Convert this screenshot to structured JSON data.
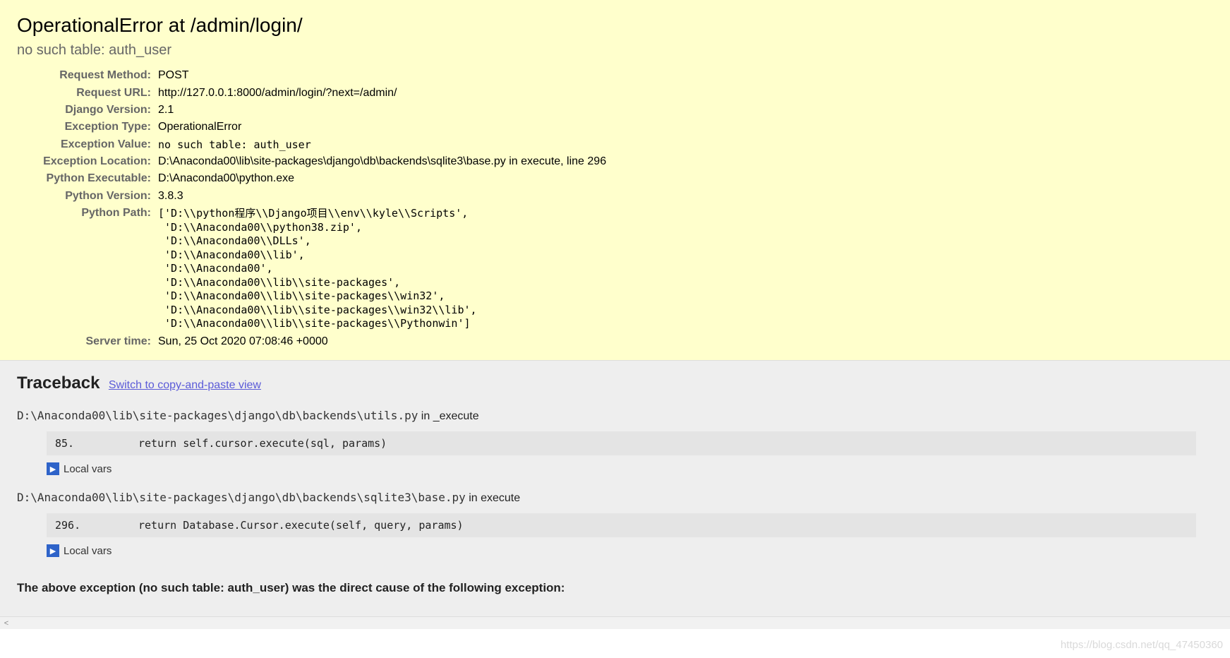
{
  "summary": {
    "title": "OperationalError at /admin/login/",
    "subtitle": "no such table: auth_user",
    "rows": {
      "request_method": {
        "label": "Request Method:",
        "value": "POST"
      },
      "request_url": {
        "label": "Request URL:",
        "value": "http://127.0.0.1:8000/admin/login/?next=/admin/"
      },
      "django_version": {
        "label": "Django Version:",
        "value": "2.1"
      },
      "exception_type": {
        "label": "Exception Type:",
        "value": "OperationalError"
      },
      "exception_value": {
        "label": "Exception Value:",
        "value": "no such table: auth_user"
      },
      "exception_location": {
        "label": "Exception Location:",
        "value": "D:\\Anaconda00\\lib\\site-packages\\django\\db\\backends\\sqlite3\\base.py in execute, line 296"
      },
      "python_executable": {
        "label": "Python Executable:",
        "value": "D:\\Anaconda00\\python.exe"
      },
      "python_version": {
        "label": "Python Version:",
        "value": "3.8.3"
      },
      "python_path": {
        "label": "Python Path:",
        "value": "['D:\\\\python程序\\\\Django项目\\\\env\\\\kyle\\\\Scripts',\n 'D:\\\\Anaconda00\\\\python38.zip',\n 'D:\\\\Anaconda00\\\\DLLs',\n 'D:\\\\Anaconda00\\\\lib',\n 'D:\\\\Anaconda00',\n 'D:\\\\Anaconda00\\\\lib\\\\site-packages',\n 'D:\\\\Anaconda00\\\\lib\\\\site-packages\\\\win32',\n 'D:\\\\Anaconda00\\\\lib\\\\site-packages\\\\win32\\\\lib',\n 'D:\\\\Anaconda00\\\\lib\\\\site-packages\\\\Pythonwin']"
      },
      "server_time": {
        "label": "Server time:",
        "value": "Sun, 25 Oct 2020 07:08:46 +0000"
      }
    }
  },
  "traceback": {
    "heading": "Traceback",
    "switch_link": "Switch to copy-and-paste view",
    "frames": [
      {
        "file": "D:\\Anaconda00\\lib\\site-packages\\django\\db\\backends\\utils.py",
        "in_word": " in ",
        "func": "_execute",
        "lineno": "85.",
        "code": "            return self.cursor.execute(sql, params)",
        "local_vars": "Local vars"
      },
      {
        "file": "D:\\Anaconda00\\lib\\site-packages\\django\\db\\backends\\sqlite3\\base.py",
        "in_word": " in ",
        "func": "execute",
        "lineno": "296.",
        "code": "    return Database.Cursor.execute(self, query, params)",
        "local_vars": "Local vars"
      }
    ],
    "cause_message": "The above exception (no such table: auth_user) was the direct cause of the following exception:"
  },
  "watermark": "https://blog.csdn.net/qq_47450360"
}
